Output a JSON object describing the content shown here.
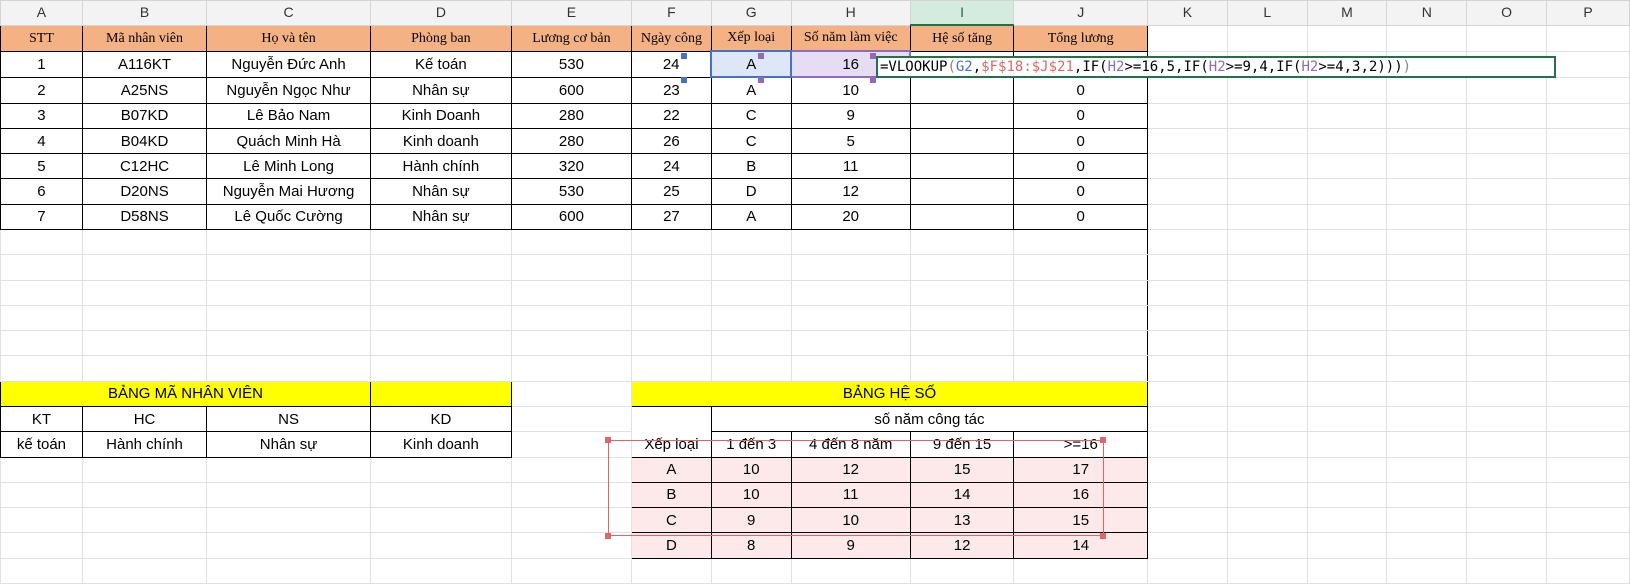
{
  "columns": [
    "A",
    "B",
    "C",
    "D",
    "E",
    "F",
    "G",
    "H",
    "I",
    "J",
    "K",
    "L",
    "M",
    "N",
    "O",
    "P"
  ],
  "active_column": "I",
  "header_row": [
    "STT",
    "Mã nhân viên",
    "Họ và tên",
    "Phòng ban",
    "Lương cơ bản",
    "Ngày công",
    "Xếp loại",
    "Số năm làm việc",
    "Hệ số tăng",
    "Tổng lương"
  ],
  "employees": [
    {
      "stt": "1",
      "ma": "A116KT",
      "ten": "Nguyễn Đức Anh",
      "phong": "Kế toán",
      "luong": "530",
      "ngay": "24",
      "xep": "A",
      "nam": "16",
      "tong": ""
    },
    {
      "stt": "2",
      "ma": "A25NS",
      "ten": "Nguyễn Ngọc Như",
      "phong": "Nhân sự",
      "luong": "600",
      "ngay": "23",
      "xep": "A",
      "nam": "10",
      "tong": "0"
    },
    {
      "stt": "3",
      "ma": "B07KD",
      "ten": "Lê Bảo Nam",
      "phong": "Kinh Doanh",
      "luong": "280",
      "ngay": "22",
      "xep": "C",
      "nam": "9",
      "tong": "0"
    },
    {
      "stt": "4",
      "ma": "B04KD",
      "ten": "Quách Minh Hà",
      "phong": "Kinh doanh",
      "luong": "280",
      "ngay": "26",
      "xep": "C",
      "nam": "5",
      "tong": "0"
    },
    {
      "stt": "5",
      "ma": "C12HC",
      "ten": "Lê Minh Long",
      "phong": "Hành chính",
      "luong": "320",
      "ngay": "24",
      "xep": "B",
      "nam": "11",
      "tong": "0"
    },
    {
      "stt": "6",
      "ma": "D20NS",
      "ten": "Nguyễn Mai Hương",
      "phong": "Nhân sự",
      "luong": "530",
      "ngay": "25",
      "xep": "D",
      "nam": "12",
      "tong": "0"
    },
    {
      "stt": "7",
      "ma": "D58NS",
      "ten": "Lê Quốc Cường",
      "phong": "Nhân sự",
      "luong": "600",
      "ngay": "27",
      "xep": "A",
      "nam": "20",
      "tong": "0"
    }
  ],
  "formula": {
    "parts": [
      {
        "t": "=VLOOKUP",
        "c": "plain"
      },
      {
        "t": "(",
        "c": "paren"
      },
      {
        "t": "G2",
        "c": "ref1"
      },
      {
        "t": ",",
        "c": "plain"
      },
      {
        "t": "$F$18:$J$21",
        "c": "ref2"
      },
      {
        "t": ",IF(",
        "c": "plain"
      },
      {
        "t": "H2",
        "c": "ref3"
      },
      {
        "t": ">=16,5,IF(",
        "c": "plain"
      },
      {
        "t": "H2",
        "c": "ref3"
      },
      {
        "t": ">=9,4,IF(",
        "c": "plain"
      },
      {
        "t": "H2",
        "c": "ref3"
      },
      {
        "t": ">=4,3,2)))",
        "c": "plain"
      },
      {
        "t": ")",
        "c": "paren"
      }
    ]
  },
  "ma_nv_table": {
    "title": "BẢNG MÃ NHÂN VIÊN",
    "codes": [
      "KT",
      "HC",
      "NS",
      "KD"
    ],
    "names": [
      "kế toán",
      "Hành chính",
      "Nhân sự",
      "Kinh doanh"
    ]
  },
  "he_so_table": {
    "title": "BẢNG HỆ SỐ",
    "subheader": "số năm công tác",
    "row_label": "Xếp loại",
    "ranges": [
      "1 đến 3",
      "4 đến 8 năm",
      "9 đến 15",
      ">=16"
    ],
    "rows": [
      {
        "grade": "A",
        "values": [
          "10",
          "12",
          "15",
          "17"
        ]
      },
      {
        "grade": "B",
        "values": [
          "10",
          "11",
          "14",
          "16"
        ]
      },
      {
        "grade": "C",
        "values": [
          "9",
          "10",
          "13",
          "15"
        ]
      },
      {
        "grade": "D",
        "values": [
          "8",
          "9",
          "12",
          "14"
        ]
      }
    ]
  },
  "colors": {
    "header_fill": "#f4b183",
    "yellow_fill": "#ffff00",
    "ref_blue": "#4472c4",
    "ref_red": "#e06666",
    "ref_purple": "#8e6bbf",
    "excel_green": "#217346"
  }
}
